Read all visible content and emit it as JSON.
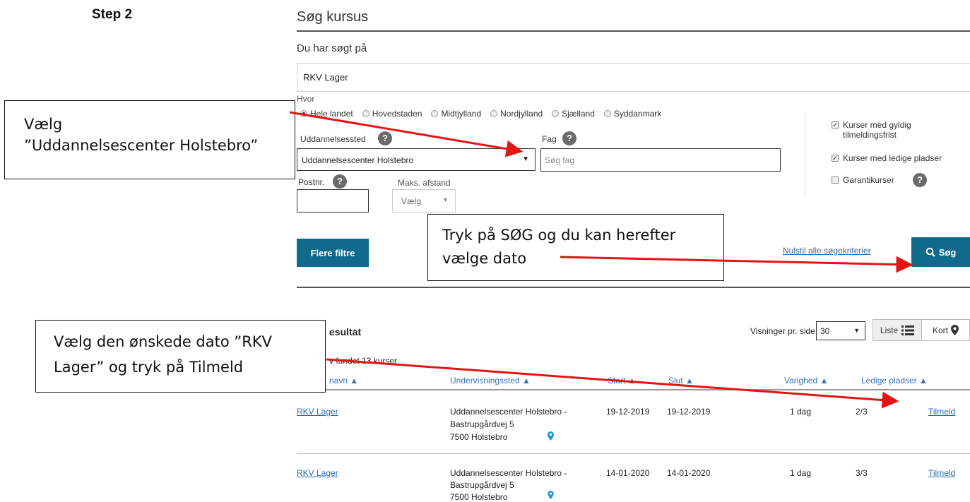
{
  "step": "Step 2",
  "page_title": "Søg kursus",
  "searched_label": "Du har søgt på",
  "query": "RKV Lager",
  "hvor_label": "Hvor",
  "regions": [
    "Hele landet",
    "Hovedstaden",
    "Midtjylland",
    "Nordjylland",
    "Sjælland",
    "Syddanmark"
  ],
  "selected_region": "Hele landet",
  "uddannelsessted_label": "Uddannelsessted",
  "uddannelsessted_value": "Uddannelsescenter Holstebro",
  "fag_label": "Fag",
  "fag_placeholder": "Søg fag",
  "postnr_label": "Postnr.",
  "maks_label": "Maks. afstand",
  "maks_value": "Vælg",
  "help_glyph": "?",
  "dropdown_arrow": "▼",
  "checkboxes": [
    {
      "label": "Kurser med gyldig tilmeldingsfrist",
      "checked": true
    },
    {
      "label": "Kurser med ledige pladser",
      "checked": true
    },
    {
      "label": "Garantikurser",
      "checked": false
    }
  ],
  "check_mark": "✓",
  "more_filters": "Flere filtre",
  "reset_link": "Nulstil alle søgekriterier",
  "search_button": "Søg",
  "results_title": "esultat",
  "found_text": "v fundet 13 kurser",
  "per_page_label": "Visninger pr. side",
  "per_page_value": "30",
  "view_list": "Liste",
  "view_map": "Kort",
  "columns": [
    "navn ▲",
    "Undervisningssted ▲",
    "Start ▲",
    "Slut ▲",
    "Varighed ▲",
    "Ledige pladser ▲"
  ],
  "rows": [
    {
      "name": "RKV Lager",
      "loc1": "Uddannelsescenter Holstebro -",
      "loc2": "Bastrupgårdvej 5",
      "loc3": "7500 Holstebro",
      "start": "19-12-2019",
      "end": "19-12-2019",
      "duration": "1 dag",
      "seats": "2/3",
      "action": "Tilmeld"
    },
    {
      "name": "RKV Lager",
      "loc1": "Uddannelsescenter Holstebro -",
      "loc2": "Bastrupgårdvej 5",
      "loc3": "7500 Holstebro",
      "start": "14-01-2020",
      "end": "14-01-2020",
      "duration": "1 dag",
      "seats": "3/3",
      "action": "Tilmeld"
    }
  ],
  "callouts": {
    "c1_line1": "Vælg",
    "c1_line2": "”Uddannelsescenter Holstebro”",
    "c2_line1": "Tryk på SØG og du kan herefter",
    "c2_line2": "vælge dato",
    "c3_line1": "Vælg den ønskede dato ”RKV",
    "c3_line2": "Lager” og tryk på Tilmeld"
  },
  "colors": {
    "accent": "#0f6a8c",
    "link": "#2a6cb0",
    "arrow": "#e31414",
    "pin": "#2196d4"
  }
}
